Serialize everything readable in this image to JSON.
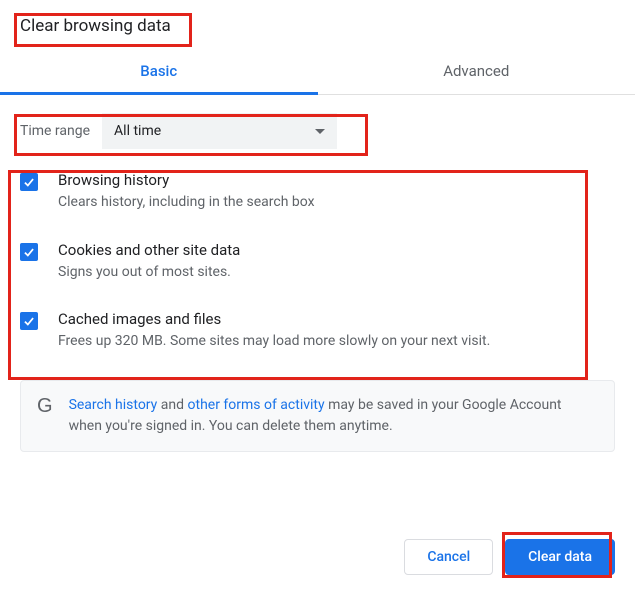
{
  "title": "Clear browsing data",
  "tabs": {
    "basic": "Basic",
    "advanced": "Advanced"
  },
  "time_range": {
    "label": "Time range",
    "value": "All time"
  },
  "options": [
    {
      "title": "Browsing history",
      "desc": "Clears history, including in the search box"
    },
    {
      "title": "Cookies and other site data",
      "desc": "Signs you out of most sites."
    },
    {
      "title": "Cached images and files",
      "desc": "Frees up 320 MB. Some sites may load more slowly on your next visit."
    }
  ],
  "info": {
    "link1": "Search history",
    "mid1": " and ",
    "link2": "other forms of activity",
    "rest": " may be saved in your Google Account when you're signed in. You can delete them anytime."
  },
  "buttons": {
    "cancel": "Cancel",
    "clear": "Clear data"
  }
}
